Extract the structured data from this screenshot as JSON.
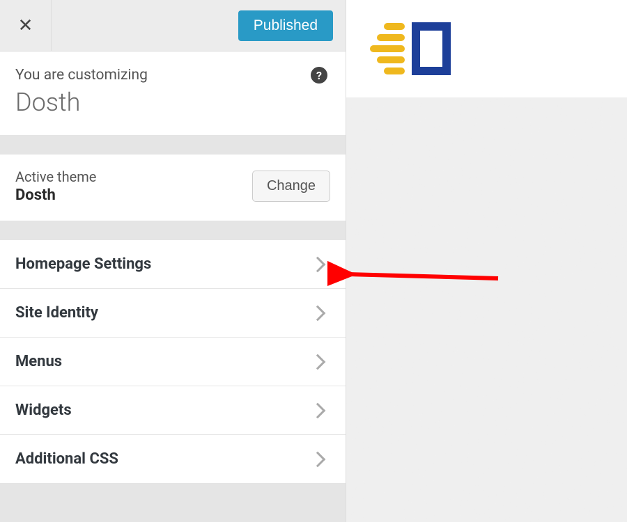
{
  "topbar": {
    "publish_label": "Published"
  },
  "info": {
    "subtitle": "You are customizing",
    "title": "Dosth"
  },
  "theme": {
    "label": "Active theme",
    "name": "Dosth",
    "change_label": "Change"
  },
  "menu": {
    "items": [
      {
        "label": "Homepage Settings"
      },
      {
        "label": "Site Identity"
      },
      {
        "label": "Menus"
      },
      {
        "label": "Widgets"
      },
      {
        "label": "Additional CSS"
      }
    ]
  },
  "help": {
    "symbol": "?"
  }
}
